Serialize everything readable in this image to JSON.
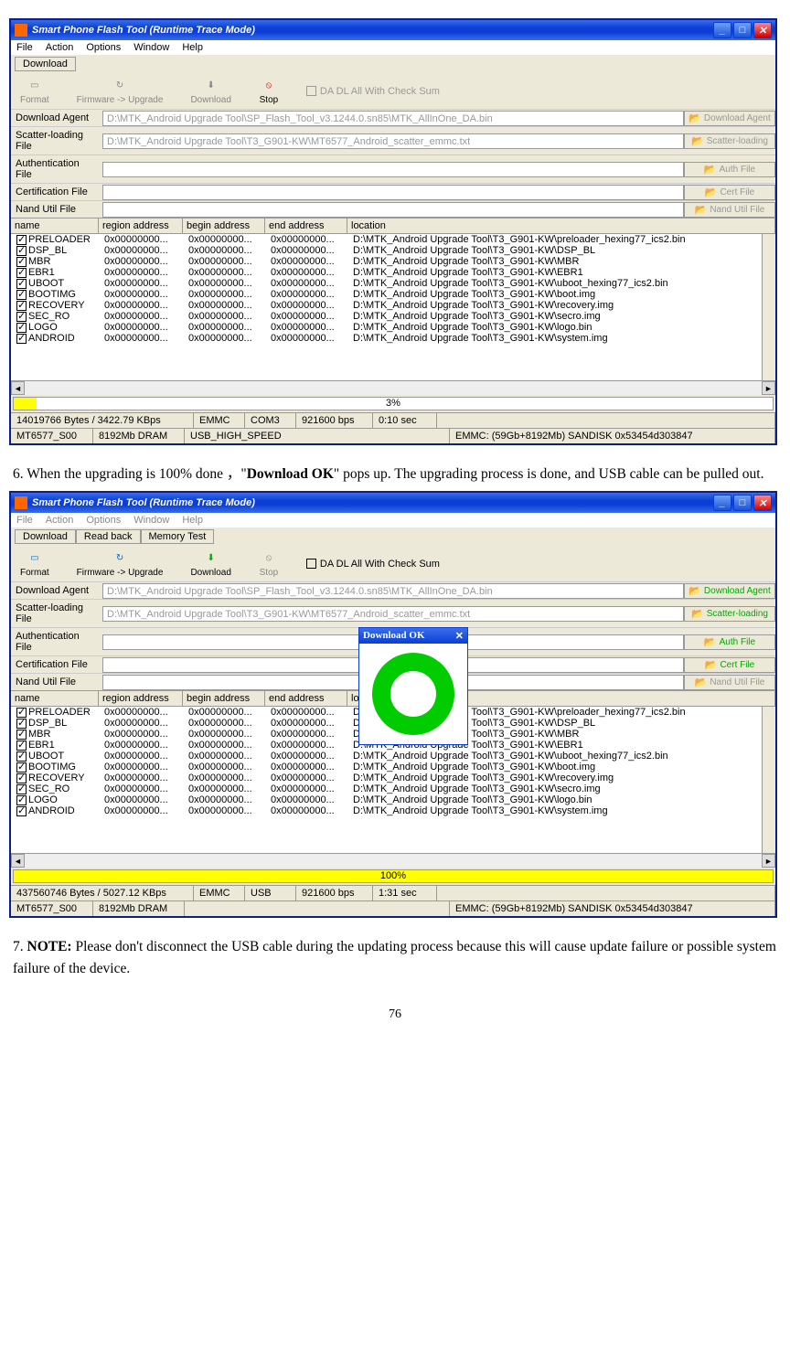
{
  "doc": {
    "step6": "6. When the upgrading is 100% done ，\"",
    "step6_bold": "Download OK",
    "step6_after": "\" pops up. The upgrading process is done, and USB cable can be pulled out.",
    "step7_pre": "7. ",
    "step7_bold": "NOTE:",
    "step7_after": " Please don't disconnect the USB cable during the updating process because this will cause update failure or possible system failure of the device.",
    "page_num": "76"
  },
  "app": {
    "title": "Smart Phone Flash Tool (Runtime Trace Mode)",
    "menus": [
      "File",
      "Action",
      "Options",
      "Window",
      "Help"
    ],
    "tabs": [
      "Download",
      "Read back",
      "Memory Test"
    ],
    "toolbar": {
      "format": "Format",
      "fwupgrade": "Firmware -> Upgrade",
      "download": "Download",
      "stop": "Stop",
      "chk": "DA DL All With Check Sum"
    },
    "filerows": [
      {
        "label": "Download Agent",
        "value": "D:\\MTK_Android Upgrade Tool\\SP_Flash_Tool_v3.1244.0.sn85\\MTK_AllInOne_DA.bin",
        "btn": "Download Agent"
      },
      {
        "label": "Scatter-loading File",
        "value": "D:\\MTK_Android Upgrade Tool\\T3_G901-KW\\MT6577_Android_scatter_emmc.txt",
        "btn": "Scatter-loading"
      },
      {
        "label": "Authentication File",
        "value": "",
        "btn": "Auth File"
      },
      {
        "label": "Certification File",
        "value": "",
        "btn": "Cert File"
      },
      {
        "label": "Nand Util File",
        "value": "",
        "btn": "Nand Util File"
      }
    ],
    "cols": {
      "name": "name",
      "ra": "region address",
      "ba": "begin address",
      "ea": "end address",
      "loc": "location"
    },
    "rows": [
      {
        "n": "PRELOADER",
        "ra": "0x00000000...",
        "ba": "0x00000000...",
        "ea": "0x00000000...",
        "l": "D:\\MTK_Android Upgrade Tool\\T3_G901-KW\\preloader_hexing77_ics2.bin"
      },
      {
        "n": "DSP_BL",
        "ra": "0x00000000...",
        "ba": "0x00000000...",
        "ea": "0x00000000...",
        "l": "D:\\MTK_Android Upgrade Tool\\T3_G901-KW\\DSP_BL"
      },
      {
        "n": "MBR",
        "ra": "0x00000000...",
        "ba": "0x00000000...",
        "ea": "0x00000000...",
        "l": "D:\\MTK_Android Upgrade Tool\\T3_G901-KW\\MBR"
      },
      {
        "n": "EBR1",
        "ra": "0x00000000...",
        "ba": "0x00000000...",
        "ea": "0x00000000...",
        "l": "D:\\MTK_Android Upgrade Tool\\T3_G901-KW\\EBR1"
      },
      {
        "n": "UBOOT",
        "ra": "0x00000000...",
        "ba": "0x00000000...",
        "ea": "0x00000000...",
        "l": "D:\\MTK_Android Upgrade Tool\\T3_G901-KW\\uboot_hexing77_ics2.bin"
      },
      {
        "n": "BOOTIMG",
        "ra": "0x00000000...",
        "ba": "0x00000000...",
        "ea": "0x00000000...",
        "l": "D:\\MTK_Android Upgrade Tool\\T3_G901-KW\\boot.img"
      },
      {
        "n": "RECOVERY",
        "ra": "0x00000000...",
        "ba": "0x00000000...",
        "ea": "0x00000000...",
        "l": "D:\\MTK_Android Upgrade Tool\\T3_G901-KW\\recovery.img"
      },
      {
        "n": "SEC_RO",
        "ra": "0x00000000...",
        "ba": "0x00000000...",
        "ea": "0x00000000...",
        "l": "D:\\MTK_Android Upgrade Tool\\T3_G901-KW\\secro.img"
      },
      {
        "n": "LOGO",
        "ra": "0x00000000...",
        "ba": "0x00000000...",
        "ea": "0x00000000...",
        "l": "D:\\MTK_Android Upgrade Tool\\T3_G901-KW\\logo.bin"
      },
      {
        "n": "ANDROID",
        "ra": "0x00000000...",
        "ba": "0x00000000...",
        "ea": "0x00000000...",
        "l": "D:\\MTK_Android Upgrade Tool\\T3_G901-KW\\system.img"
      }
    ]
  },
  "shot1": {
    "progress_pct": "3%",
    "progress_width": "3%",
    "status1": [
      "14019766 Bytes / 3422.79 KBps",
      "EMMC",
      "COM3",
      "921600 bps",
      "0:10 sec",
      ""
    ],
    "status2": [
      "MT6577_S00",
      "8192Mb DRAM",
      "USB_HIGH_SPEED",
      "EMMC: (59Gb+8192Mb) SANDISK 0x53454d303847"
    ]
  },
  "shot2": {
    "progress_pct": "100%",
    "progress_width": "100%",
    "status1": [
      "437560746 Bytes / 5027.12 KBps",
      "EMMC",
      "USB",
      "921600 bps",
      "1:31 sec",
      ""
    ],
    "status2": [
      "MT6577_S00",
      "8192Mb DRAM",
      "",
      "EMMC: (59Gb+8192Mb) SANDISK 0x53454d303847"
    ],
    "popup_title": "Download OK"
  }
}
